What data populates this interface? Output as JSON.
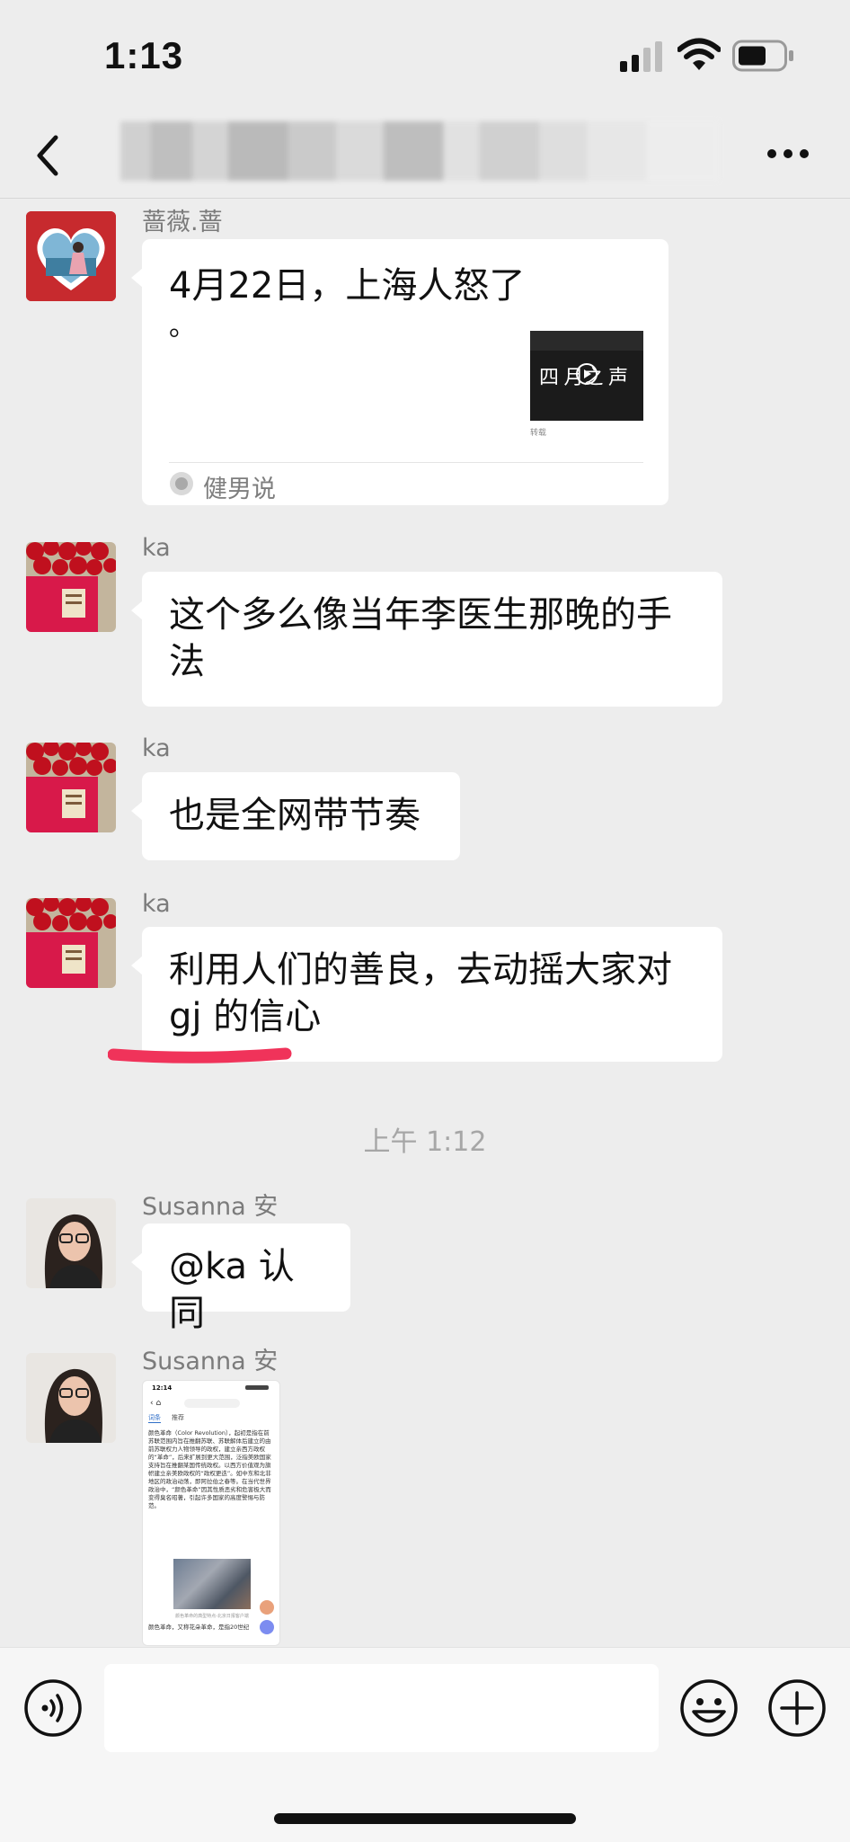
{
  "status_bar": {
    "time": "1:13"
  },
  "header": {
    "title_blurred": ""
  },
  "messages": [
    {
      "sender": "蔷薇.蔷",
      "card": {
        "title_line1": "4月22日，上海人怒了",
        "title_line2": "。",
        "thumb_text": "四 月之 声",
        "thumb_small": "转载",
        "source": "健男说"
      }
    },
    {
      "sender": "ka",
      "text_line1": "这个多么像当年李医生那晚的手",
      "text_line2": "法"
    },
    {
      "sender": "ka",
      "text_line1": "也是全网带节奏"
    },
    {
      "sender": "ka",
      "text_line1": "利用人们的善良，去动摇大家对",
      "text_line2": "gj 的信心"
    },
    {
      "timestamp": "上午 1:12"
    },
    {
      "sender": "Susanna 安",
      "text_line1": "@ka 认同"
    },
    {
      "sender": "Susanna 安",
      "screenshot": {
        "time": "12:14",
        "tabs": [
          "词条",
          "推荐"
        ],
        "paragraph": "颜色革命（Color Revolution），起初是指在前苏联范围内旨在推翻苏联、苏联解体后建立的由前苏联权力人物领导的政权，建立亲西方政权的“革命”，后来扩展到更大范围，泛指美欧国家支持旨在推翻某国传统政权。以西方价值观为旗帜建立亲美欧政权的“政权更迭”。如中东和北非地区的政治动荡，即阿拉伯之春等。在当代世界政治中，“颜色革命”因其性质恶劣和危害极大而变得臭名昭著，引起许多国家的高度警惕与防范。",
        "caption": "颜色革命的典型特点-北京日报客户端",
        "footer": "颜色革命，又称花朵革命，是指20世纪"
      }
    }
  ],
  "input_bar": {
    "voice": "voice-icon",
    "emoji": "emoji-icon",
    "plus": "plus-icon"
  }
}
